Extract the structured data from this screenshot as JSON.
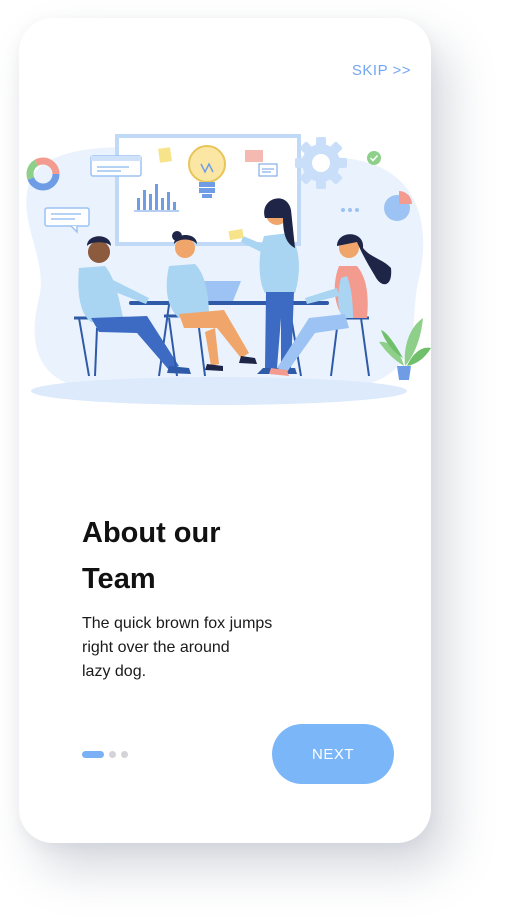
{
  "header": {
    "skip_label": "SKIP >>"
  },
  "slide": {
    "title_lines": [
      "About our",
      "Team"
    ],
    "description_lines": [
      "The quick brown fox jumps",
      "right over the around",
      "lazy dog."
    ]
  },
  "pagination": {
    "total": 3,
    "current": 1
  },
  "footer": {
    "next_label": "NEXT"
  },
  "colors": {
    "accent": "#74A7F2",
    "button": "#7AB6F8",
    "dot_inactive": "#d4d4d8",
    "title": "#111111"
  },
  "icons": [
    "lightbulb-icon",
    "gear-icon",
    "donut-chart-icon",
    "pie-chart-icon",
    "check-icon",
    "chat-bubble-icon"
  ]
}
